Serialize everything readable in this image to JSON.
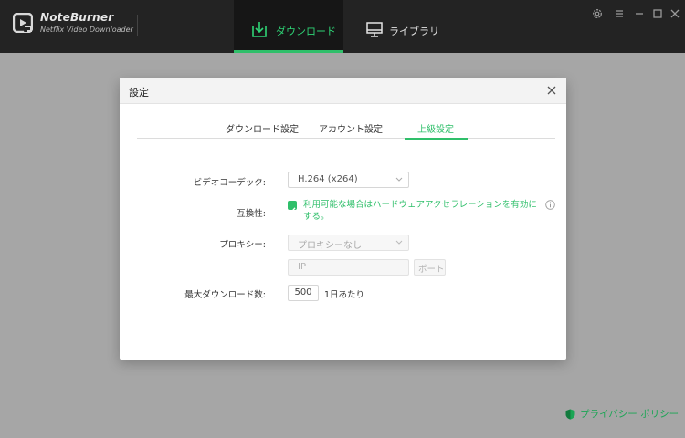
{
  "app": {
    "name": "NoteBurner",
    "subtitle": "Netflix Video Downloader"
  },
  "nav": {
    "download": "ダウンロード",
    "library": "ライブラリ"
  },
  "dialog": {
    "title": "設定",
    "tabs": [
      "ダウンロード設定",
      "アカウント設定",
      "上級設定"
    ],
    "active_tab": "上級設定",
    "fields": {
      "video_codec_label": "ビデオコーデック:",
      "video_codec_value": "H.264 (x264)",
      "compat_label": "互換性:",
      "compat_checked": true,
      "compat_text": "利用可能な場合はハードウェアアクセラレーションを有効にする。",
      "proxy_label": "プロキシー:",
      "proxy_value": "プロキシーなし",
      "ip_placeholder": "IP",
      "port_placeholder": "ポート",
      "max_downloads_label": "最大ダウンロード数:",
      "max_downloads_value": "500",
      "per_day": "1日あたり"
    }
  },
  "footer": {
    "privacy": "プライバシー ポリシー"
  },
  "colors": {
    "accent": "#2fbf6a",
    "titlebar": "#232323",
    "overlay": "#a6a6a6"
  }
}
